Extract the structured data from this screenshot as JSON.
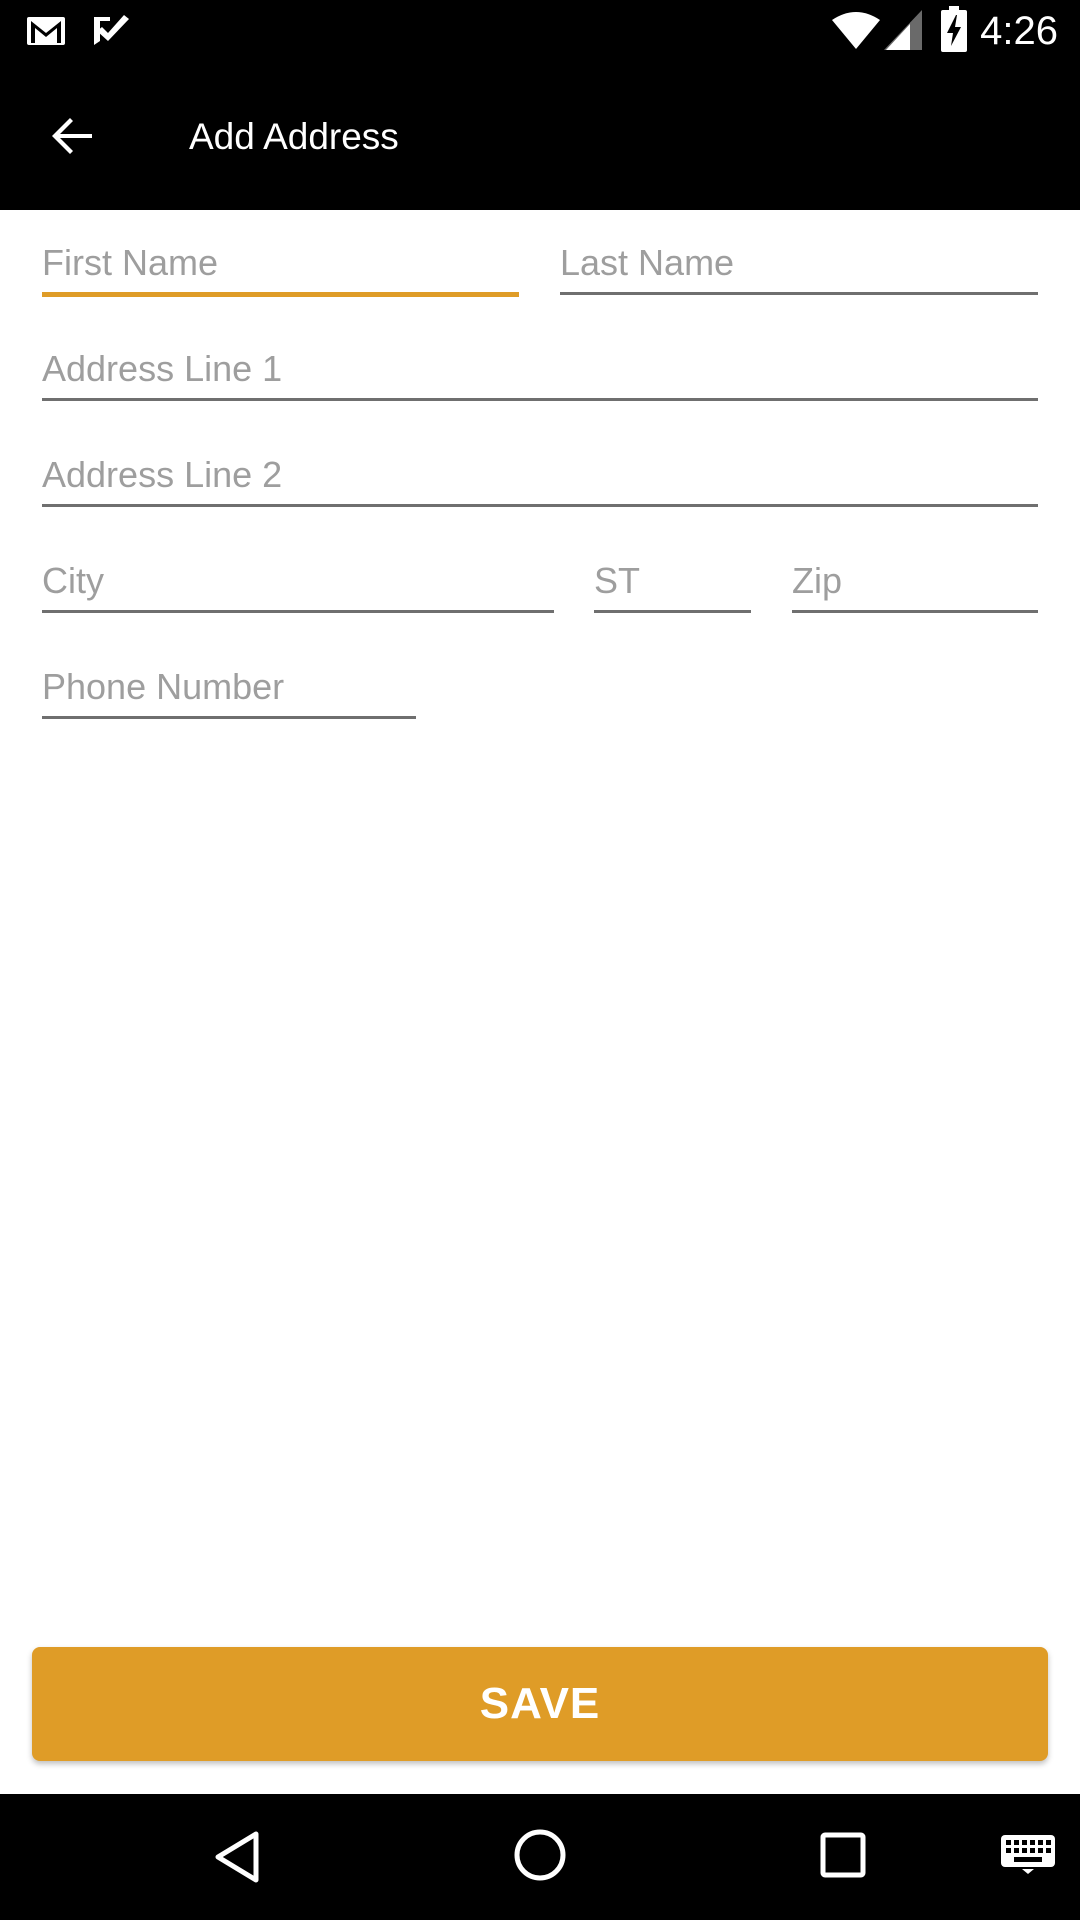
{
  "status_bar": {
    "time": "4:26",
    "icons": [
      "gmail-icon",
      "task-check-icon",
      "wifi-icon",
      "signal-icon",
      "battery-charging-icon"
    ]
  },
  "app_bar": {
    "title": "Add Address",
    "back_icon": "arrow-back-icon"
  },
  "form": {
    "first_name": {
      "placeholder": "First Name",
      "value": ""
    },
    "last_name": {
      "placeholder": "Last Name",
      "value": ""
    },
    "address_line_1": {
      "placeholder": "Address Line 1",
      "value": ""
    },
    "address_line_2": {
      "placeholder": "Address Line 2",
      "value": ""
    },
    "city": {
      "placeholder": "City",
      "value": ""
    },
    "state": {
      "placeholder": "ST",
      "value": ""
    },
    "zip": {
      "placeholder": "Zip",
      "value": ""
    },
    "phone": {
      "placeholder": "Phone Number",
      "value": ""
    }
  },
  "save_button": {
    "label": "SAVE"
  },
  "nav_bar": {
    "icons": [
      "back-triangle-icon",
      "home-circle-icon",
      "recents-square-icon",
      "keyboard-icon"
    ]
  },
  "colors": {
    "accent": "#df9c27",
    "bar_background": "#000000",
    "placeholder": "#9e9e9e",
    "underline": "#6f6f6f"
  }
}
